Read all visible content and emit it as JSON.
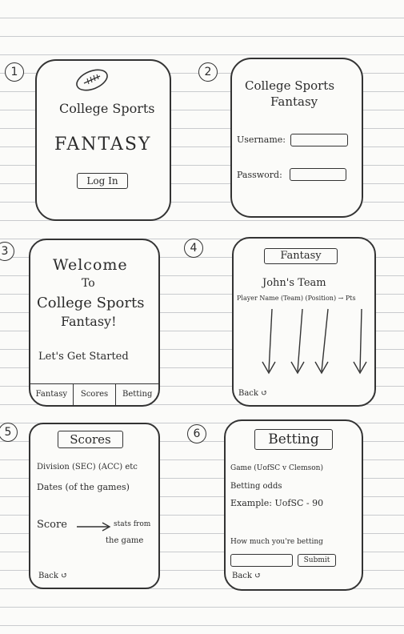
{
  "screens": {
    "s1": {
      "num": "1",
      "title": "College Sports",
      "subtitle": "FANTASY",
      "login": "Log In"
    },
    "s2": {
      "num": "2",
      "title1": "College Sports",
      "title2": "Fantasy",
      "username": "Username:",
      "password": "Password:"
    },
    "s3": {
      "num": "3",
      "l1": "Welcome",
      "l2": "To",
      "l3": "College Sports",
      "l4": "Fantasy!",
      "l5": "Let's Get Started",
      "nav": [
        "Fantasy",
        "Scores",
        "Betting"
      ]
    },
    "s4": {
      "num": "4",
      "title": "Fantasy",
      "team": "John's Team",
      "cols": "Player Name (Team) (Position) → Pts",
      "back": "Back ↺"
    },
    "s5": {
      "num": "5",
      "title": "Scores",
      "l1": "Division (SEC) (ACC) etc",
      "l2": "Dates (of the games)",
      "l3": "Score",
      "l4": "stats from",
      "l5": "the game",
      "back": "Back ↺"
    },
    "s6": {
      "num": "6",
      "title": "Betting",
      "l1": "Game (UofSC v Clemson)",
      "l2": "Betting odds",
      "l3": "Example: UofSC - 90",
      "l4": "How much you're betting",
      "submit": "Submit",
      "back": "Back ↺"
    }
  }
}
